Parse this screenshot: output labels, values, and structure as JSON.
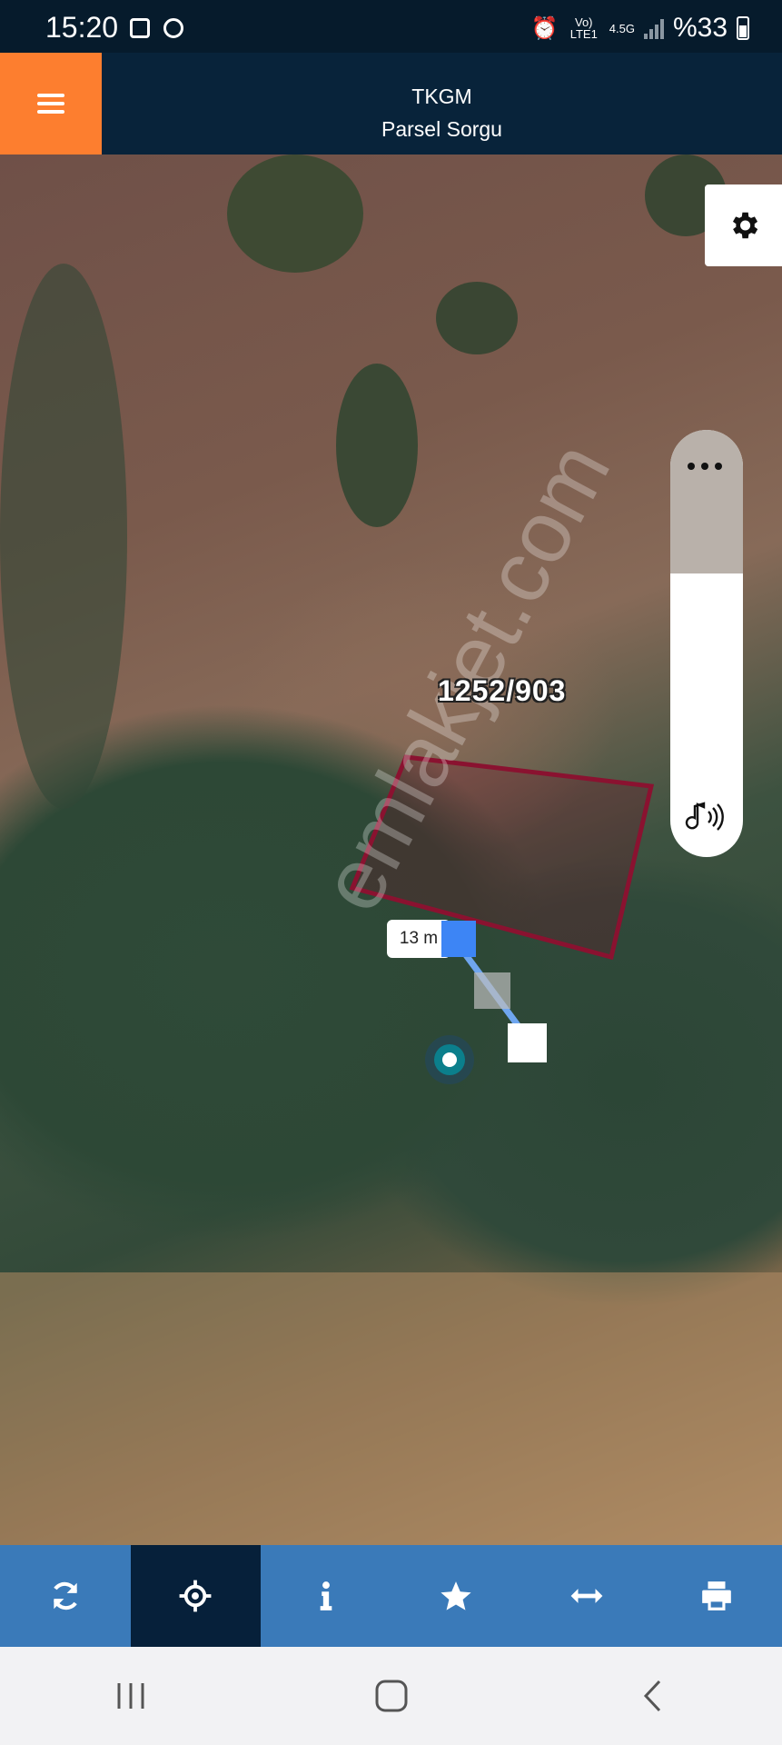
{
  "status_bar": {
    "time": "15:20",
    "network": "Vo) LTE1",
    "network_type": "4.5G",
    "battery": "%33"
  },
  "header": {
    "title_line1": "TKGM",
    "title_line2": "Parsel Sorgu"
  },
  "map": {
    "parcel_label": "1252/903",
    "measurement": "13 m",
    "watermark": "emlakjet.com"
  },
  "toolbar": {
    "items": [
      {
        "icon": "refresh-icon"
      },
      {
        "icon": "locate-icon",
        "active": true
      },
      {
        "icon": "info-icon"
      },
      {
        "icon": "star-icon"
      },
      {
        "icon": "measure-icon"
      },
      {
        "icon": "print-icon"
      }
    ]
  },
  "colors": {
    "menu_accent": "#fd7e2f",
    "header_bg": "#08233a",
    "toolbar_bg": "#3a7ab9",
    "toolbar_active": "#06203a",
    "parcel_outline": "#8a1230",
    "measure_handle": "#3d85f5"
  }
}
